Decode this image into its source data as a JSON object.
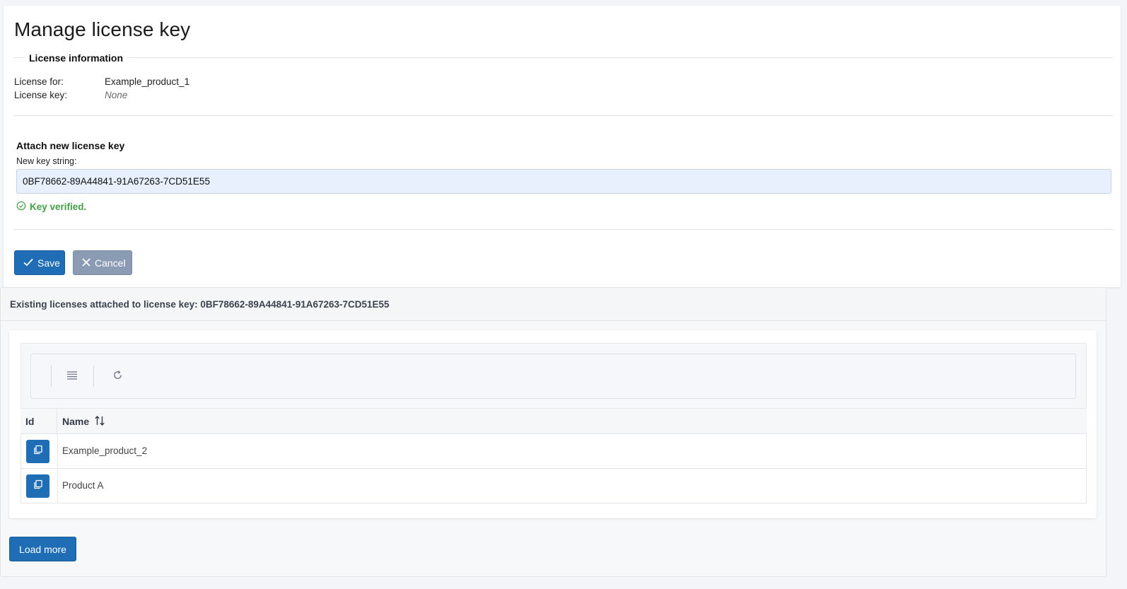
{
  "page": {
    "title": "Manage license key"
  },
  "license_info": {
    "legend": "License information",
    "for_label": "License for:",
    "for_value": "Example_product_1",
    "key_label": "License key:",
    "key_value": "None"
  },
  "attach": {
    "title": "Attach new license key",
    "field_label": "New key string:",
    "key_value": "0BF78662-89A44841-91A67263-7CD51E55",
    "status": "Key verified.",
    "status_color": "#43a047",
    "status_icon": "check-circle-icon"
  },
  "actions": {
    "save_label": "Save",
    "save_icon": "checkmark-icon",
    "cancel_label": "Cancel",
    "cancel_icon": "close-icon"
  },
  "existing": {
    "header": "Existing licenses attached to license key: 0BF78662-89A44841-91A67263-7CD51E55",
    "toolbar_icons": [
      "list-icon",
      "refresh-icon"
    ],
    "columns": [
      "Id",
      "Name"
    ],
    "name_sort_icon": "sort-icon",
    "rows": [
      {
        "name": "Example_product_2",
        "id_icon": "copy-icon"
      },
      {
        "name": "Product A",
        "id_icon": "copy-icon"
      }
    ],
    "load_more_label": "Load more"
  },
  "colors": {
    "primary": "#1e6db5",
    "secondary": "#8a9bb3",
    "input_bg": "#e8f0fe"
  }
}
